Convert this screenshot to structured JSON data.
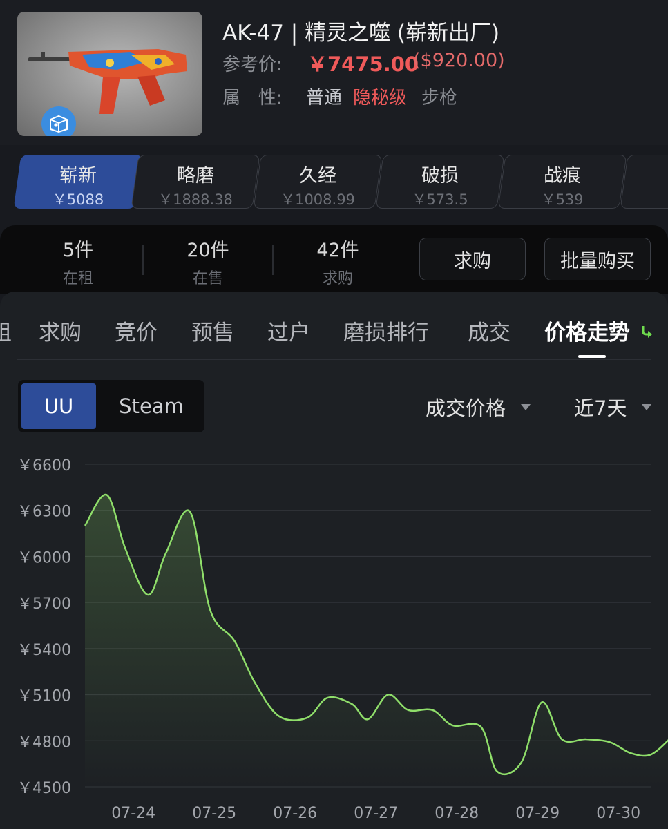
{
  "item": {
    "title": "AK-47 | 精灵之噬 (崭新出厂)",
    "ref_price_label": "参考价:",
    "price_cny": "￥7475.00",
    "price_usd": "($920.00)",
    "attr_label": "属　性:",
    "attr_quality": "普通",
    "attr_rarity": "隐秘级",
    "attr_type": "步枪"
  },
  "wear_tabs": [
    {
      "name": "崭新",
      "price": "￥5088",
      "active": true
    },
    {
      "name": "略磨",
      "price": "￥1888.38",
      "active": false
    },
    {
      "name": "久经",
      "price": "￥1008.99",
      "active": false
    },
    {
      "name": "破损",
      "price": "￥573.5",
      "active": false
    },
    {
      "name": "战痕",
      "price": "￥539",
      "active": false
    }
  ],
  "stats": [
    {
      "count": "5件",
      "label": "在租"
    },
    {
      "count": "20件",
      "label": "在售"
    },
    {
      "count": "42件",
      "label": "求购"
    }
  ],
  "actions": {
    "buy_request": "求购",
    "bulk_buy": "批量购买"
  },
  "nav_tabs": [
    "租",
    "求购",
    "竞价",
    "预售",
    "过户",
    "磨损排行",
    "成交",
    "价格走势"
  ],
  "nav_active": "价格走势",
  "source_toggle": {
    "options": [
      "UU",
      "Steam"
    ],
    "selected": "UU"
  },
  "filters": {
    "metric": "成交价格",
    "range": "近7天"
  },
  "colors": {
    "accent_blue": "#2d4c99",
    "price_red": "#ef5a5a",
    "line_green": "#8fde6a",
    "trend_green": "#6fdc4e"
  },
  "chart_data": {
    "type": "line",
    "ylim": [
      4500,
      6600
    ],
    "y_ticks": [
      "￥6600",
      "￥6300",
      "￥6000",
      "￥5700",
      "￥5400",
      "￥5100",
      "￥4800",
      "￥4500"
    ],
    "y_tick_values": [
      6600,
      6300,
      6000,
      5700,
      5400,
      5100,
      4800,
      4500
    ],
    "x_ticks": [
      "07-24",
      "07-25",
      "07-26",
      "07-27",
      "07-28",
      "07-29",
      "07-30"
    ],
    "x_range": [
      0,
      7
    ],
    "x_tick_positions": [
      0.6,
      1.6,
      2.6,
      3.6,
      4.6,
      5.6,
      6.6
    ],
    "grid": true,
    "series": [
      {
        "points": [
          [
            0.0,
            6200
          ],
          [
            0.27,
            6400
          ],
          [
            0.5,
            6050
          ],
          [
            0.78,
            5750
          ],
          [
            1.0,
            6020
          ],
          [
            1.3,
            6290
          ],
          [
            1.55,
            5650
          ],
          [
            1.85,
            5450
          ],
          [
            2.1,
            5180
          ],
          [
            2.4,
            4960
          ],
          [
            2.75,
            4950
          ],
          [
            3.0,
            5080
          ],
          [
            3.3,
            5040
          ],
          [
            3.5,
            4940
          ],
          [
            3.75,
            5100
          ],
          [
            4.0,
            5000
          ],
          [
            4.3,
            5000
          ],
          [
            4.55,
            4900
          ],
          [
            4.9,
            4890
          ],
          [
            5.1,
            4600
          ],
          [
            5.4,
            4660
          ],
          [
            5.65,
            5050
          ],
          [
            5.9,
            4810
          ],
          [
            6.2,
            4810
          ],
          [
            6.5,
            4790
          ],
          [
            6.75,
            4720
          ],
          [
            7.0,
            4710
          ],
          [
            7.25,
            4820
          ]
        ]
      }
    ]
  }
}
